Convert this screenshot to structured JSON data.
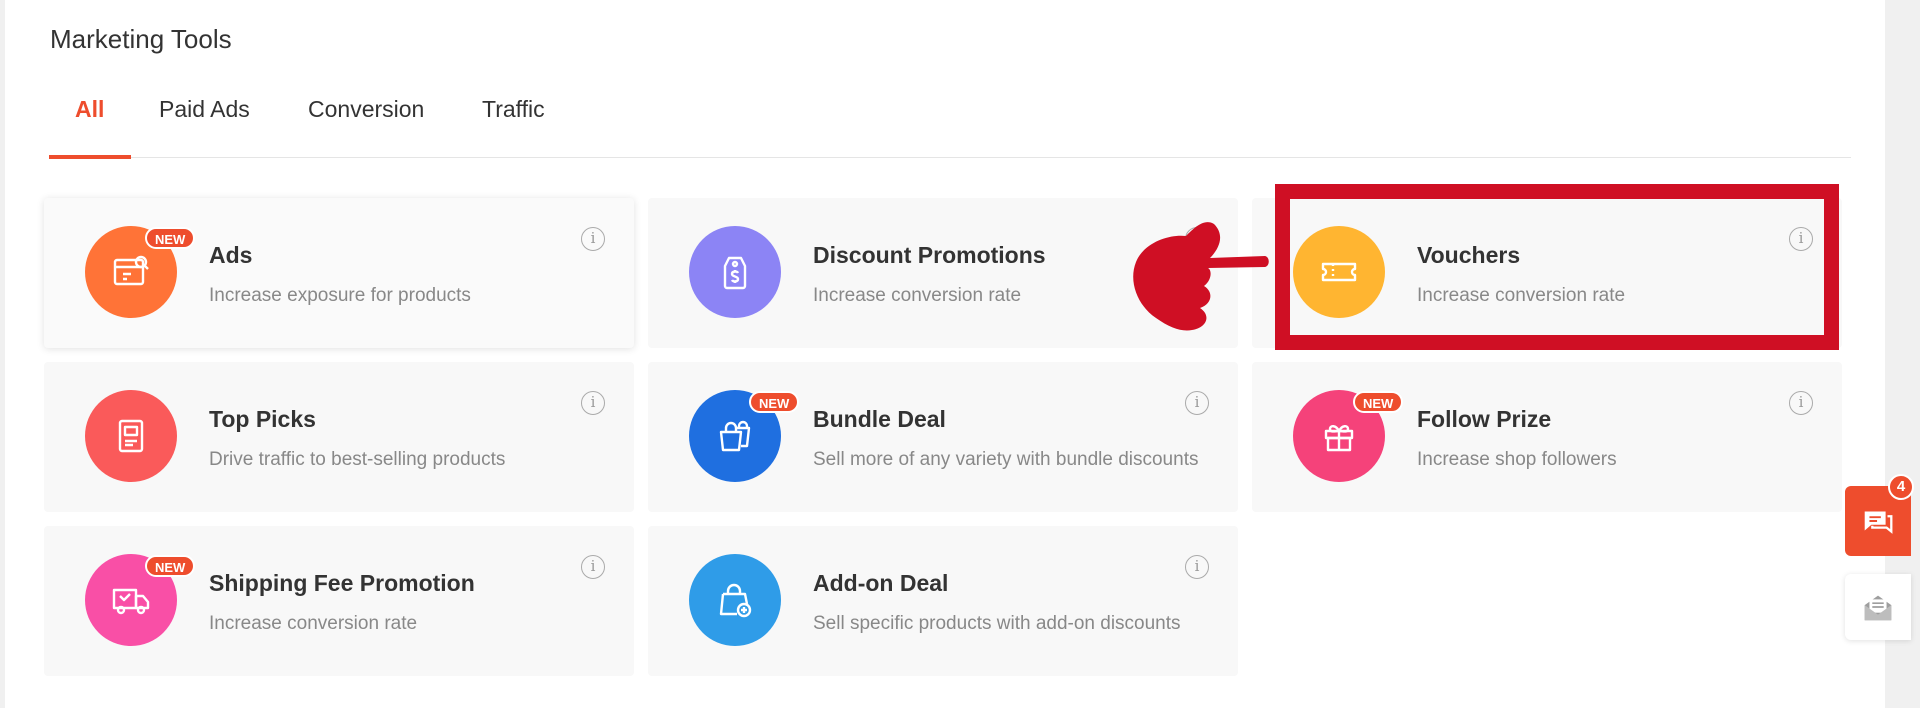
{
  "page": {
    "title": "Marketing Tools"
  },
  "tabs": [
    {
      "label": "All",
      "active": true
    },
    {
      "label": "Paid Ads",
      "active": false
    },
    {
      "label": "Conversion",
      "active": false
    },
    {
      "label": "Traffic",
      "active": false
    }
  ],
  "new_badge": "NEW",
  "info_glyph": "i",
  "cards": [
    {
      "title": "Ads",
      "description": "Increase exposure for products",
      "icon": "ads-icon",
      "color": "#ff7337",
      "is_new": true
    },
    {
      "title": "Discount Promotions",
      "description": "Increase conversion rate",
      "icon": "price-tag-icon",
      "color": "#8c84f5",
      "is_new": false
    },
    {
      "title": "Vouchers",
      "description": "Increase conversion rate",
      "icon": "ticket-icon",
      "color": "#ffb531",
      "is_new": false
    },
    {
      "title": "Top Picks",
      "description": "Drive traffic to best-selling products",
      "icon": "document-icon",
      "color": "#fa5a5a",
      "is_new": false
    },
    {
      "title": "Bundle Deal",
      "description": "Sell more of any variety with bundle discounts",
      "icon": "shopping-bags-icon",
      "color": "#1f6fe0",
      "is_new": true
    },
    {
      "title": "Follow Prize",
      "description": "Increase shop followers",
      "icon": "gift-icon",
      "color": "#f5427a",
      "is_new": true
    },
    {
      "title": "Shipping Fee Promotion",
      "description": "Increase conversion rate",
      "icon": "truck-icon",
      "color": "#f94fa6",
      "is_new": true
    },
    {
      "title": "Add-on Deal",
      "description": "Sell specific products with add-on discounts",
      "icon": "bag-plus-icon",
      "color": "#2f9ce8",
      "is_new": false
    }
  ],
  "chat": {
    "unread_count": "4",
    "color": "#ee4d2d"
  },
  "annotation": {
    "highlight_color": "#cf0f24",
    "highlighted_card": "Vouchers"
  }
}
